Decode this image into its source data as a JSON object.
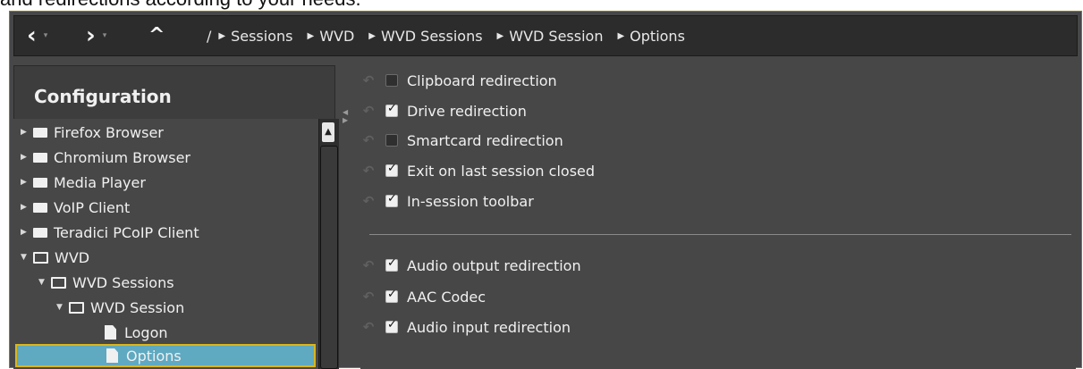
{
  "doc_text": "and redirections according to your needs.",
  "nav": {
    "back_icon": "‹",
    "forward_icon": "›",
    "up_icon": "^",
    "breadcrumb_root": "/",
    "breadcrumb": [
      "Sessions",
      "WVD",
      "WVD Sessions",
      "WVD Session",
      "Options"
    ]
  },
  "sidebar": {
    "title": "Configuration",
    "tree": [
      {
        "label": "Firefox Browser",
        "expanded": false
      },
      {
        "label": "Chromium Browser",
        "expanded": false
      },
      {
        "label": "Media Player",
        "expanded": false
      },
      {
        "label": "VoIP Client",
        "expanded": false
      },
      {
        "label": "Teradici PCoIP Client",
        "expanded": false
      },
      {
        "label": "WVD",
        "expanded": true
      },
      {
        "label": "WVD Sessions",
        "expanded": true
      },
      {
        "label": "WVD Session",
        "expanded": true
      },
      {
        "label": "Logon"
      },
      {
        "label": "Options",
        "selected": true
      }
    ]
  },
  "options": {
    "group1": [
      {
        "label": "Clipboard redirection",
        "checked": false
      },
      {
        "label": "Drive redirection",
        "checked": true
      },
      {
        "label": "Smartcard redirection",
        "checked": false
      },
      {
        "label": "Exit on last session closed",
        "checked": true
      },
      {
        "label": "In-session toolbar",
        "checked": true
      }
    ],
    "group2": [
      {
        "label": "Audio output redirection",
        "checked": true
      },
      {
        "label": "AAC Codec",
        "checked": true
      },
      {
        "label": "Audio input redirection",
        "checked": true
      }
    ]
  },
  "colors": {
    "window_bg": "#474747",
    "navbar_bg": "#2c2c2c",
    "selection_bg": "#5fa9c1",
    "selection_border": "#d9b51e",
    "frame_border": "#8a7a2e"
  }
}
